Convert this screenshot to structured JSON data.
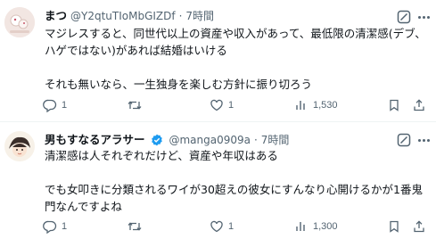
{
  "posts": [
    {
      "name": "まつ",
      "handle": "@Y2qtuTIoMbGIZDf",
      "separator": "·",
      "time": "7時間",
      "body": [
        "マジレスすると、同世代以上の資産や収入があって、最低限の清潔感(デブ、",
        "ハゲではない)があれば結婚はいける",
        "",
        "それも無いなら、一生独身を楽しむ方針に振り切ろう"
      ],
      "stats": {
        "replies": "1",
        "retweets": "",
        "likes": "1",
        "views": "1,530"
      },
      "verified": false
    },
    {
      "name": "男もすなるアラサー",
      "handle": "@manga0909a",
      "separator": "·",
      "time": "7時間",
      "body": [
        "清潔感は人それぞれだけど、資産や年収はある",
        "",
        "でも女叩きに分類されるワイが30超えの彼女にすんなり心開けるかが1番鬼",
        "門なんですよね"
      ],
      "stats": {
        "replies": "1",
        "retweets": "",
        "likes": "1",
        "views": "1,300"
      },
      "verified": true
    }
  ],
  "colors": {
    "text": "#0f1419",
    "secondary": "#536471",
    "verified": "#1d9bf0",
    "border": "#eff3f4"
  },
  "icons": [
    "grok-icon",
    "more-icon",
    "reply-icon",
    "retweet-icon",
    "like-icon",
    "views-icon",
    "bookmark-icon",
    "share-icon",
    "verified-badge-icon"
  ]
}
